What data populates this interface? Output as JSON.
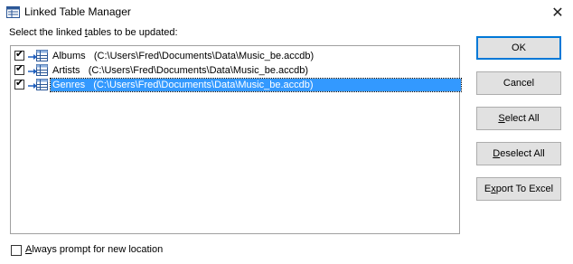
{
  "window": {
    "title": "Linked Table Manager",
    "title_icon": "table-manager-icon",
    "close_label": "✕"
  },
  "prompt": {
    "before": "Select the linked ",
    "accel": "t",
    "after": "ables to be updated:"
  },
  "tables": [
    {
      "text": "Albums   (C:\\Users\\Fred\\Documents\\Data\\Music_be.accdb)",
      "checked": true,
      "selected": false
    },
    {
      "text": "Artists   (C:\\Users\\Fred\\Documents\\Data\\Music_be.accdb)",
      "checked": true,
      "selected": false
    },
    {
      "text": "Genres   (C:\\Users\\Fred\\Documents\\Data\\Music_be.accdb)",
      "checked": true,
      "selected": true
    }
  ],
  "buttons": {
    "ok": "OK",
    "cancel": "Cancel",
    "select_all": {
      "accel": "S",
      "rest": "elect All"
    },
    "deselect_all": {
      "accel": "D",
      "rest": "eselect All"
    },
    "export": {
      "before": "E",
      "accel": "x",
      "rest": "port To Excel"
    }
  },
  "always_prompt": {
    "accel": "A",
    "rest": "lways prompt for new location",
    "checked": false
  },
  "colors": {
    "selection": "#3399ff",
    "default_button_border": "#0078d7",
    "button_face": "#e1e1e1"
  }
}
